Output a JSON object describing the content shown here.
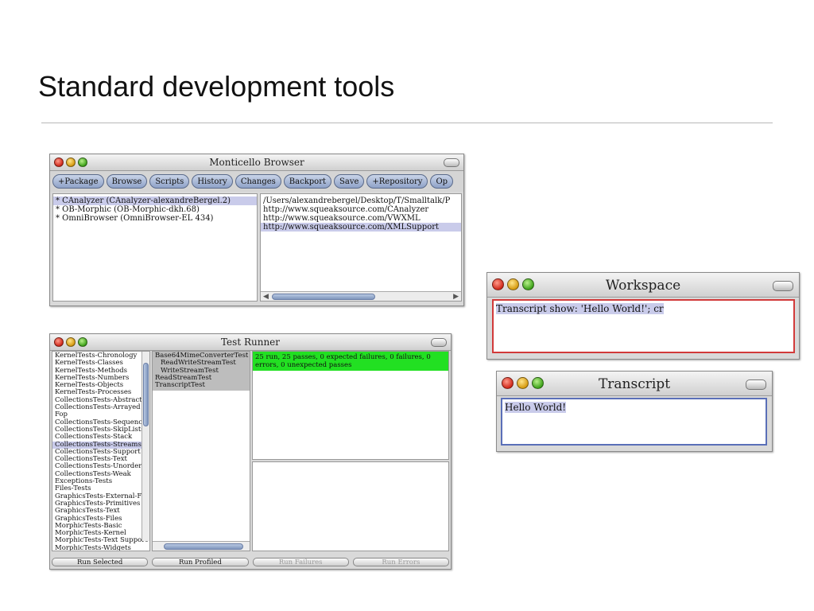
{
  "slide": {
    "title": "Standard development tools"
  },
  "monticello": {
    "title": "Monticello Browser",
    "toolbar": [
      "+Package",
      "Browse",
      "Scripts",
      "History",
      "Changes",
      "Backport",
      "Save",
      "+Repository",
      "Op"
    ],
    "packages": [
      "* CAnalyzer (CAnalyzer-alexandreBergel.2)",
      "* OB-Morphic (OB-Morphic-dkh.68)",
      "* OmniBrowser (OmniBrowser-EL 434)"
    ],
    "repositories": [
      "/Users/alexandrebergel/Desktop/T/Smalltalk/P",
      "http://www.squeaksource.com/CAnalyzer",
      "http://www.squeaksource.com/VWXML",
      "http://www.squeaksource.com/XMLSupport"
    ]
  },
  "testrunner": {
    "title": "Test Runner",
    "categories": [
      "KernelTests-Chronology",
      "KernelTests-Classes",
      "KernelTests-Methods",
      "KernelTests-Numbers",
      "KernelTests-Objects",
      "KernelTests-Processes",
      "CollectionsTests-Abstract",
      "CollectionsTests-Arrayed",
      "Fop",
      "CollectionsTests-Sequence",
      "CollectionsTests-SkipLists",
      "CollectionsTests-Stack",
      "CollectionsTests-Streams",
      "CollectionsTests-Support",
      "CollectionsTests-Text",
      "CollectionsTests-Unordered",
      "CollectionsTests-Weak",
      "Exceptions-Tests",
      "Files-Tests",
      "GraphicsTests-External-Filters",
      "GraphicsTests-Primitives",
      "GraphicsTests-Text",
      "GraphicsTests-Files",
      "MorphicTests-Basic",
      "MorphicTests-Kernel",
      "MorphicTests-Text Support",
      "MorphicTests-Widgets"
    ],
    "classes": [
      "Base64MimeConverterTest",
      "ReadWriteStreamTest",
      "WriteStreamTest",
      "ReadStreamTest",
      "TranscriptTest"
    ],
    "result": "25 run, 25 passes, 0 expected failures, 0 failures, 0 errors, 0 unexpected passes",
    "buttons": [
      "Run Selected",
      "Run Profiled",
      "Run Failures",
      "Run Errors"
    ]
  },
  "workspace": {
    "title": "Workspace",
    "content": "Transcript show: 'Hello World!'; cr"
  },
  "transcript": {
    "title": "Transcript",
    "content": "Hello World!"
  }
}
